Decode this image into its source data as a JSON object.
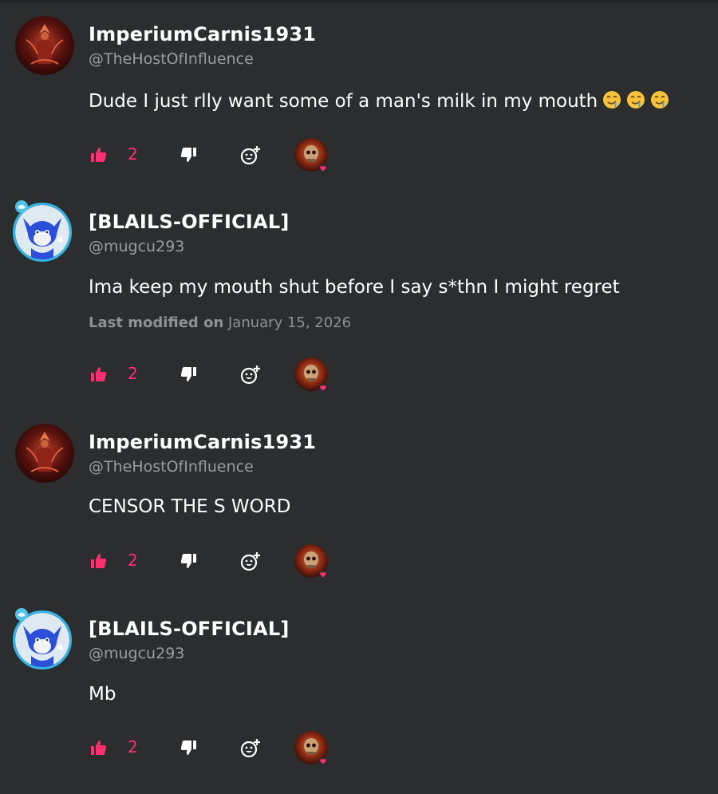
{
  "comments": [
    {
      "username": "ImperiumCarnis1931",
      "handle": "@TheHostOfInfluence",
      "text": "Dude I just rlly want some of a man's milk in my mouth",
      "emojis": [
        "drooling-face-emoji",
        "drooling-face-emoji",
        "drooling-face-emoji"
      ],
      "like_count": "2",
      "avatar_icon": "red-demon-avatar"
    },
    {
      "username": "[BLAILS-OFFICIAL]",
      "handle": "@mugcu293",
      "text": "Ima keep my mouth shut before I say s*thn I might regret",
      "modified_label": "Last modified on",
      "modified_date": "January 15, 2026",
      "like_count": "2",
      "avatar_icon": "blue-fox-avatar"
    },
    {
      "username": "ImperiumCarnis1931",
      "handle": "@TheHostOfInfluence",
      "text": "CENSOR THE S WORD",
      "like_count": "2",
      "avatar_icon": "red-demon-avatar"
    },
    {
      "username": "[BLAILS-OFFICIAL]",
      "handle": "@mugcu293",
      "text": "Mb",
      "like_count": "2",
      "avatar_icon": "blue-fox-avatar"
    }
  ],
  "colors": {
    "background": "#2b2d2e",
    "accent": "#ff2f72",
    "handle": "#9a9c9e",
    "avatar_ring": "#33b6e6"
  }
}
